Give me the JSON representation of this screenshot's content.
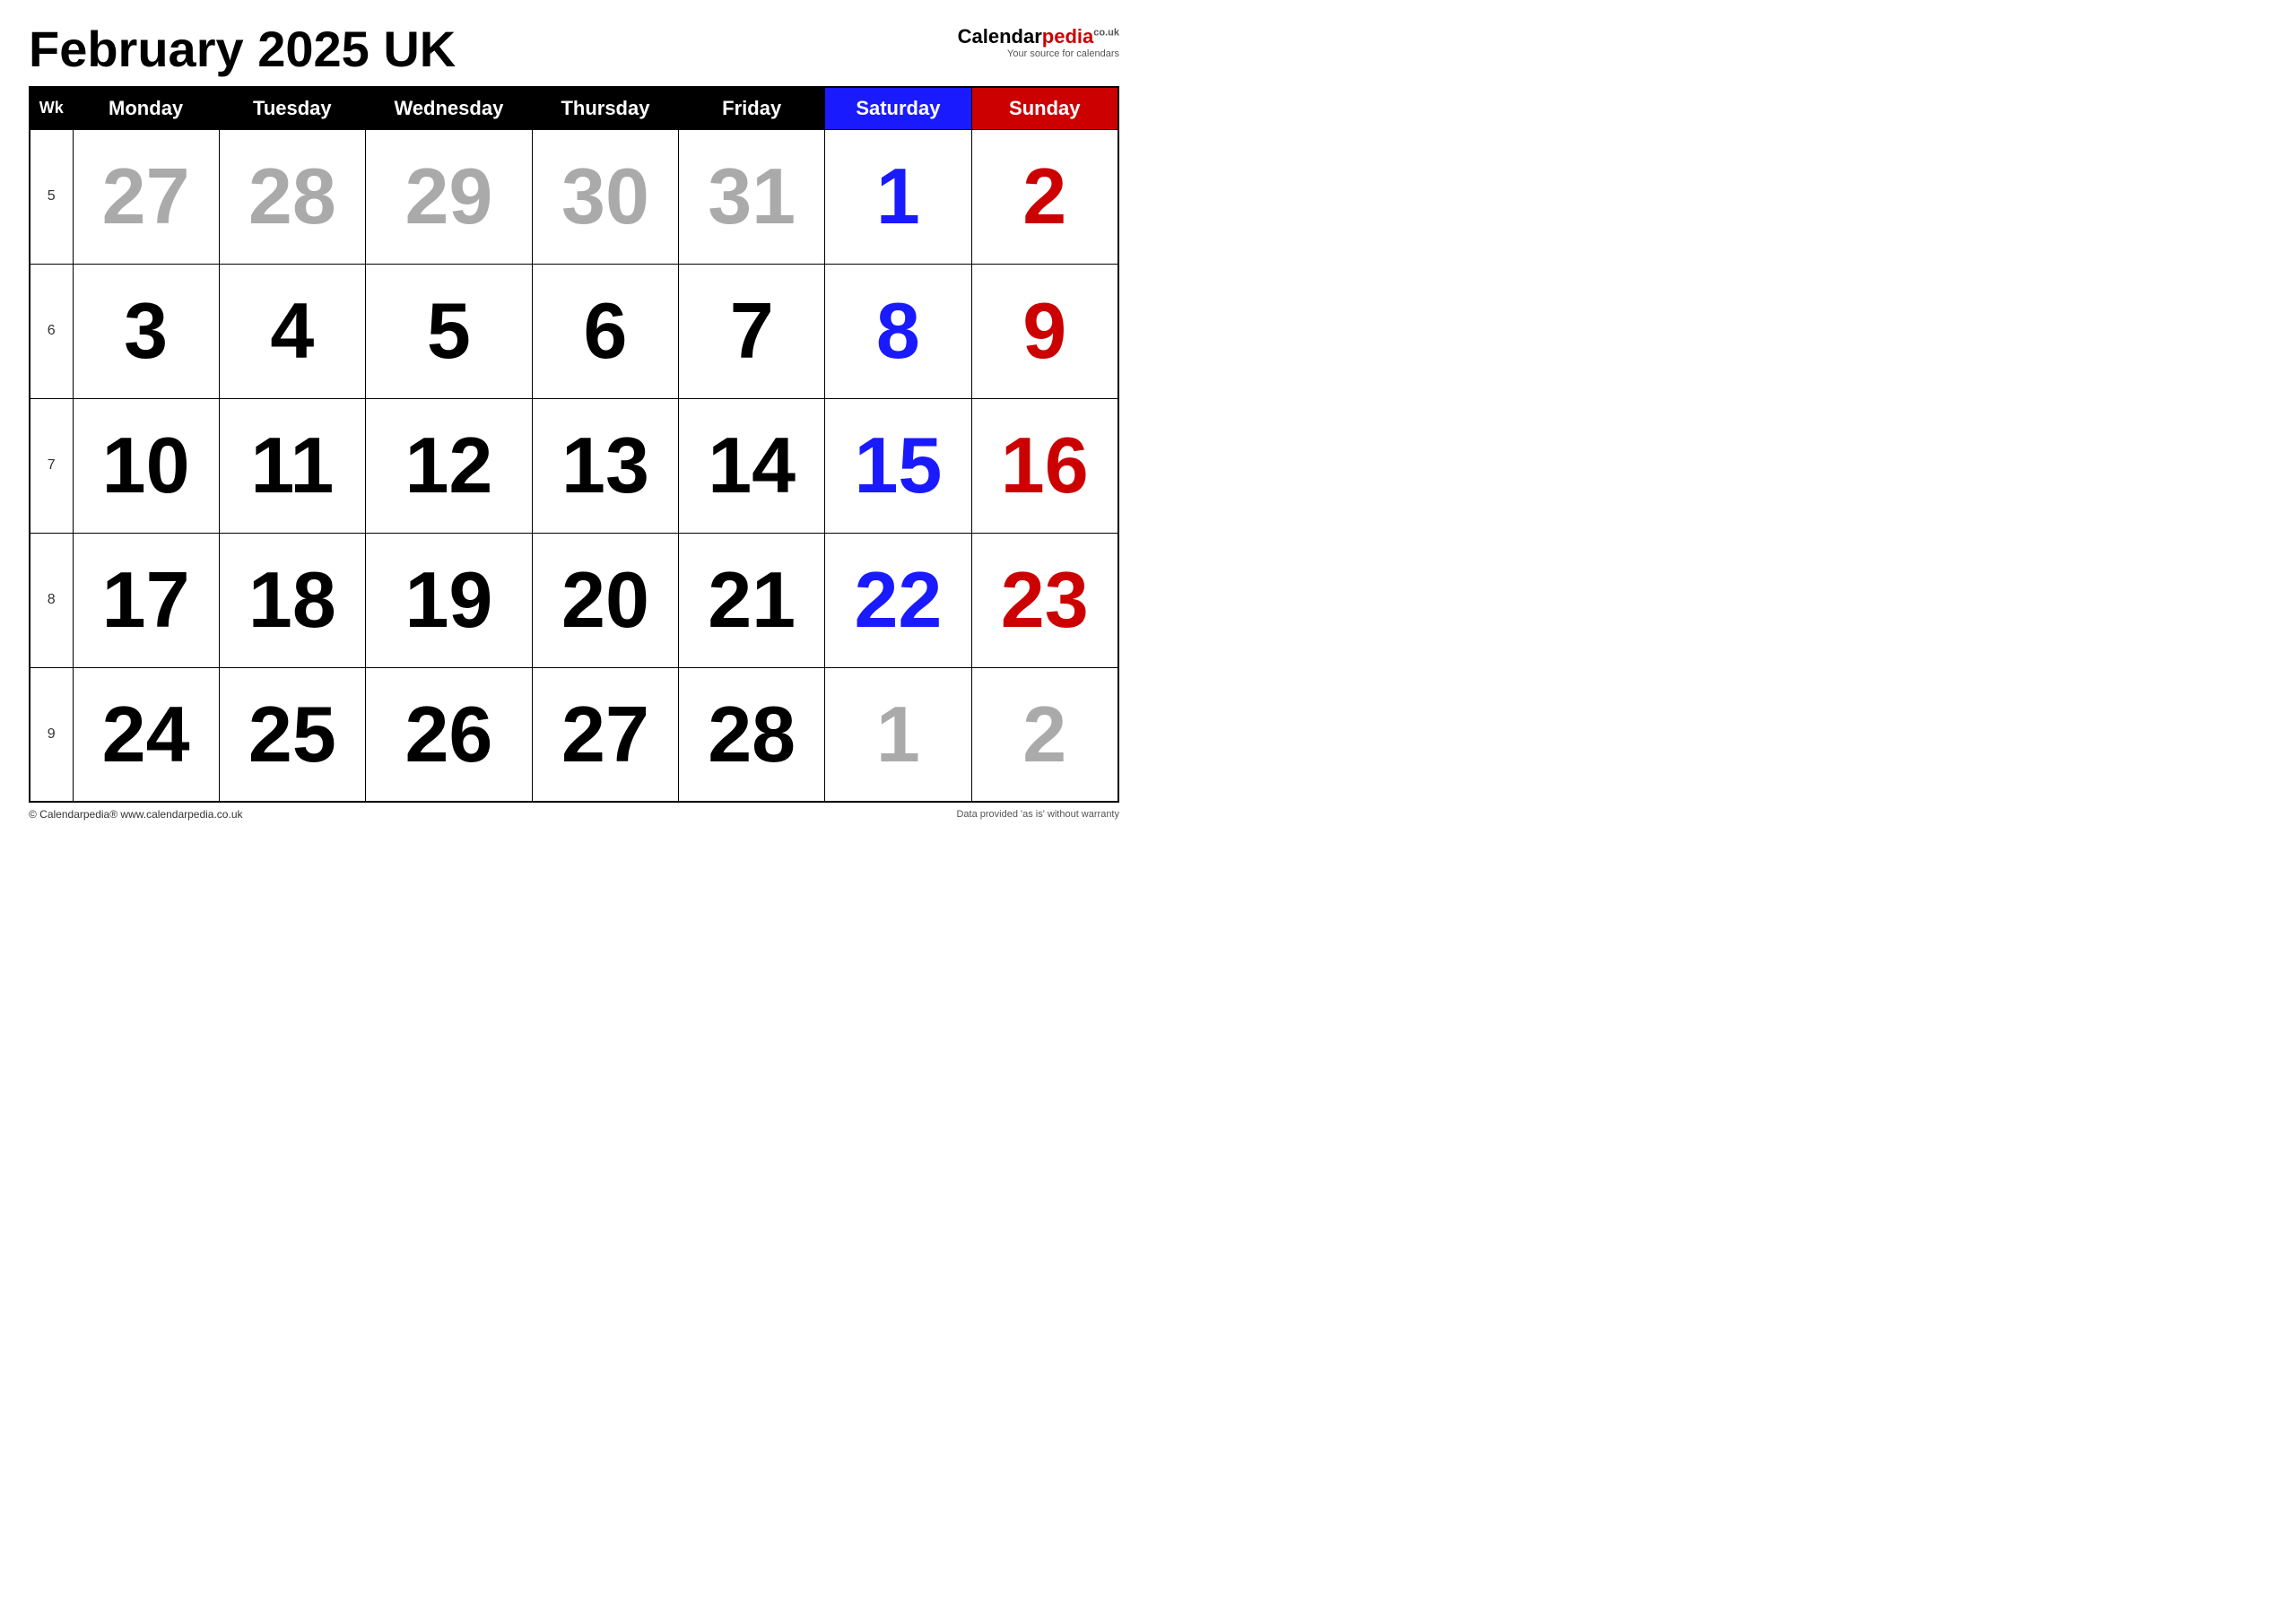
{
  "page": {
    "title": "February 2025 UK",
    "logo": {
      "name_part1": "Calendar",
      "name_part2": "pedia",
      "co_uk": "co.uk",
      "tagline": "Your source for calendars"
    },
    "footer_left": "© Calendarpedia®  www.calendarpedia.co.uk",
    "footer_right": "Data provided 'as is' without warranty"
  },
  "headers": {
    "wk": "Wk",
    "mon": "Monday",
    "tue": "Tuesday",
    "wed": "Wednesday",
    "thu": "Thursday",
    "fri": "Friday",
    "sat": "Saturday",
    "sun": "Sunday"
  },
  "weeks": [
    {
      "wk": "5",
      "days": [
        {
          "num": "27",
          "color": "grey"
        },
        {
          "num": "28",
          "color": "grey"
        },
        {
          "num": "29",
          "color": "grey"
        },
        {
          "num": "30",
          "color": "grey"
        },
        {
          "num": "31",
          "color": "grey"
        },
        {
          "num": "1",
          "color": "blue"
        },
        {
          "num": "2",
          "color": "red"
        }
      ]
    },
    {
      "wk": "6",
      "days": [
        {
          "num": "3",
          "color": "black"
        },
        {
          "num": "4",
          "color": "black"
        },
        {
          "num": "5",
          "color": "black"
        },
        {
          "num": "6",
          "color": "black"
        },
        {
          "num": "7",
          "color": "black"
        },
        {
          "num": "8",
          "color": "blue"
        },
        {
          "num": "9",
          "color": "red"
        }
      ]
    },
    {
      "wk": "7",
      "days": [
        {
          "num": "10",
          "color": "black"
        },
        {
          "num": "11",
          "color": "black"
        },
        {
          "num": "12",
          "color": "black"
        },
        {
          "num": "13",
          "color": "black"
        },
        {
          "num": "14",
          "color": "black"
        },
        {
          "num": "15",
          "color": "blue"
        },
        {
          "num": "16",
          "color": "red"
        }
      ]
    },
    {
      "wk": "8",
      "days": [
        {
          "num": "17",
          "color": "black"
        },
        {
          "num": "18",
          "color": "black"
        },
        {
          "num": "19",
          "color": "black"
        },
        {
          "num": "20",
          "color": "black"
        },
        {
          "num": "21",
          "color": "black"
        },
        {
          "num": "22",
          "color": "blue"
        },
        {
          "num": "23",
          "color": "red"
        }
      ]
    },
    {
      "wk": "9",
      "days": [
        {
          "num": "24",
          "color": "black"
        },
        {
          "num": "25",
          "color": "black"
        },
        {
          "num": "26",
          "color": "black"
        },
        {
          "num": "27",
          "color": "black"
        },
        {
          "num": "28",
          "color": "black"
        },
        {
          "num": "1",
          "color": "grey"
        },
        {
          "num": "2",
          "color": "grey"
        }
      ]
    }
  ]
}
